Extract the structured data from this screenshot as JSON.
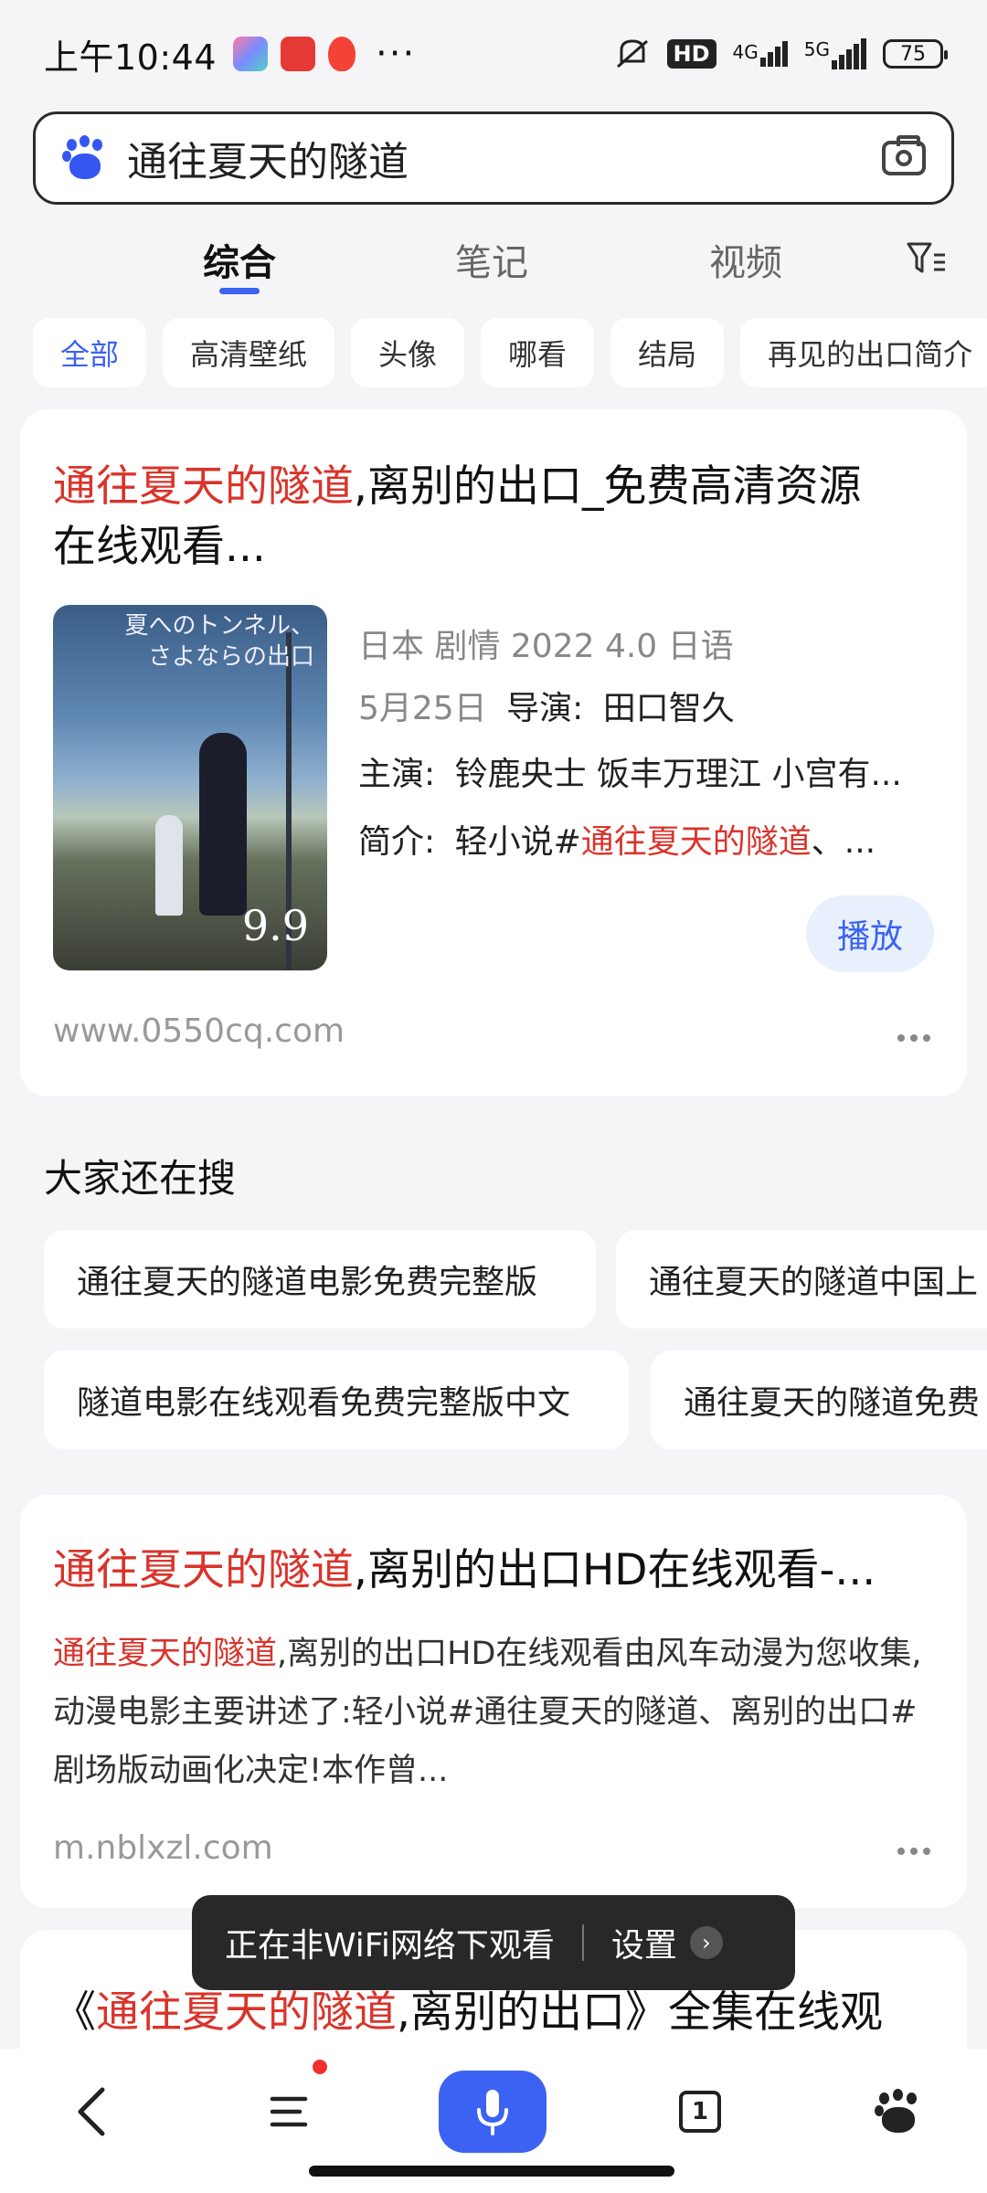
{
  "status_bar": {
    "time": "上午10:44",
    "more": "···",
    "hd_label": "HD",
    "net1": "4G",
    "net2": "5G",
    "battery": "75"
  },
  "search": {
    "query": "通往夏天的隧道"
  },
  "tabs": [
    {
      "label": "综合",
      "active": true
    },
    {
      "label": "笔记",
      "active": false
    },
    {
      "label": "视频",
      "active": false
    }
  ],
  "chips": [
    "全部",
    "高清壁纸",
    "头像",
    "哪看",
    "结局",
    "再见的出口简介"
  ],
  "result1": {
    "title_hl": "通往夏天的隧道",
    "title_rest": ",离别的出口_免费高清资源",
    "title_line2": "在线观看...",
    "poster_text_1": "夏へのトンネル、",
    "poster_text_2": "さよならの出口",
    "poster_date": "9.9",
    "meta_line1": "日本  剧情  2022  4.0  日语",
    "meta_date": "5月25日",
    "director_label": "导演:",
    "director": "田口智久",
    "cast_label": "主演:",
    "cast": "铃鹿央士 饭丰万理江 小宫有...",
    "intro_label": "简介:",
    "intro_pre": "轻小说#",
    "intro_hl": "通往夏天的隧道",
    "intro_post": "、...",
    "play_label": "播放",
    "url": "www.0550cq.com"
  },
  "related": {
    "title": "大家还在搜",
    "items": [
      "通往夏天的隧道电影免费完整版",
      "通往夏天的隧道中国上",
      "隧道电影在线观看免费完整版中文",
      "通往夏天的隧道免费"
    ]
  },
  "result2": {
    "title_hl": "通往夏天的隧道",
    "title_rest": ",离别的出口HD在线观看-...",
    "snippet_hl": "通往夏天的隧道",
    "snippet_rest": ",离别的出口HD在线观看由风车动漫为您收集,动漫电影主要讲述了:轻小说#通往夏天的隧道、离别的出口#剧场版动画化决定!本作曾...",
    "url": "m.nblxzl.com"
  },
  "result3": {
    "title_pre": "《",
    "title_hl": "通往夏天的隧道",
    "title_rest": ",离别的出口》全集在线观"
  },
  "toast": {
    "message": "正在非WiFi网络下观看",
    "action": "设置"
  },
  "bottom_nav": {
    "tab_count": "1"
  },
  "colors": {
    "accent": "#3b62f2",
    "highlight": "#d9342b"
  }
}
